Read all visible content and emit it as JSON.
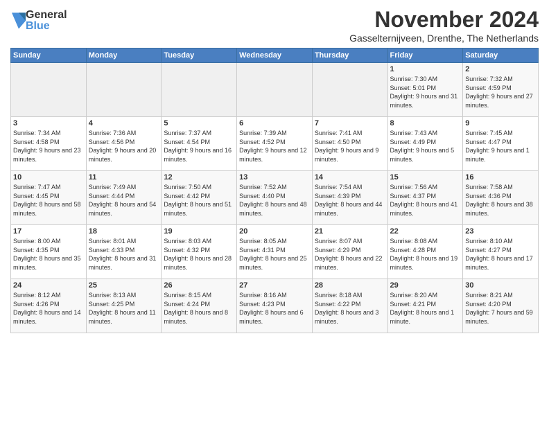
{
  "logo": {
    "general": "General",
    "blue": "Blue"
  },
  "title": {
    "month": "November 2024",
    "location": "Gasselternijveen, Drenthe, The Netherlands"
  },
  "weekdays": [
    "Sunday",
    "Monday",
    "Tuesday",
    "Wednesday",
    "Thursday",
    "Friday",
    "Saturday"
  ],
  "weeks": [
    [
      {
        "day": "",
        "info": ""
      },
      {
        "day": "",
        "info": ""
      },
      {
        "day": "",
        "info": ""
      },
      {
        "day": "",
        "info": ""
      },
      {
        "day": "",
        "info": ""
      },
      {
        "day": "1",
        "info": "Sunrise: 7:30 AM\nSunset: 5:01 PM\nDaylight: 9 hours and 31 minutes."
      },
      {
        "day": "2",
        "info": "Sunrise: 7:32 AM\nSunset: 4:59 PM\nDaylight: 9 hours and 27 minutes."
      }
    ],
    [
      {
        "day": "3",
        "info": "Sunrise: 7:34 AM\nSunset: 4:58 PM\nDaylight: 9 hours and 23 minutes."
      },
      {
        "day": "4",
        "info": "Sunrise: 7:36 AM\nSunset: 4:56 PM\nDaylight: 9 hours and 20 minutes."
      },
      {
        "day": "5",
        "info": "Sunrise: 7:37 AM\nSunset: 4:54 PM\nDaylight: 9 hours and 16 minutes."
      },
      {
        "day": "6",
        "info": "Sunrise: 7:39 AM\nSunset: 4:52 PM\nDaylight: 9 hours and 12 minutes."
      },
      {
        "day": "7",
        "info": "Sunrise: 7:41 AM\nSunset: 4:50 PM\nDaylight: 9 hours and 9 minutes."
      },
      {
        "day": "8",
        "info": "Sunrise: 7:43 AM\nSunset: 4:49 PM\nDaylight: 9 hours and 5 minutes."
      },
      {
        "day": "9",
        "info": "Sunrise: 7:45 AM\nSunset: 4:47 PM\nDaylight: 9 hours and 1 minute."
      }
    ],
    [
      {
        "day": "10",
        "info": "Sunrise: 7:47 AM\nSunset: 4:45 PM\nDaylight: 8 hours and 58 minutes."
      },
      {
        "day": "11",
        "info": "Sunrise: 7:49 AM\nSunset: 4:44 PM\nDaylight: 8 hours and 54 minutes."
      },
      {
        "day": "12",
        "info": "Sunrise: 7:50 AM\nSunset: 4:42 PM\nDaylight: 8 hours and 51 minutes."
      },
      {
        "day": "13",
        "info": "Sunrise: 7:52 AM\nSunset: 4:40 PM\nDaylight: 8 hours and 48 minutes."
      },
      {
        "day": "14",
        "info": "Sunrise: 7:54 AM\nSunset: 4:39 PM\nDaylight: 8 hours and 44 minutes."
      },
      {
        "day": "15",
        "info": "Sunrise: 7:56 AM\nSunset: 4:37 PM\nDaylight: 8 hours and 41 minutes."
      },
      {
        "day": "16",
        "info": "Sunrise: 7:58 AM\nSunset: 4:36 PM\nDaylight: 8 hours and 38 minutes."
      }
    ],
    [
      {
        "day": "17",
        "info": "Sunrise: 8:00 AM\nSunset: 4:35 PM\nDaylight: 8 hours and 35 minutes."
      },
      {
        "day": "18",
        "info": "Sunrise: 8:01 AM\nSunset: 4:33 PM\nDaylight: 8 hours and 31 minutes."
      },
      {
        "day": "19",
        "info": "Sunrise: 8:03 AM\nSunset: 4:32 PM\nDaylight: 8 hours and 28 minutes."
      },
      {
        "day": "20",
        "info": "Sunrise: 8:05 AM\nSunset: 4:31 PM\nDaylight: 8 hours and 25 minutes."
      },
      {
        "day": "21",
        "info": "Sunrise: 8:07 AM\nSunset: 4:29 PM\nDaylight: 8 hours and 22 minutes."
      },
      {
        "day": "22",
        "info": "Sunrise: 8:08 AM\nSunset: 4:28 PM\nDaylight: 8 hours and 19 minutes."
      },
      {
        "day": "23",
        "info": "Sunrise: 8:10 AM\nSunset: 4:27 PM\nDaylight: 8 hours and 17 minutes."
      }
    ],
    [
      {
        "day": "24",
        "info": "Sunrise: 8:12 AM\nSunset: 4:26 PM\nDaylight: 8 hours and 14 minutes."
      },
      {
        "day": "25",
        "info": "Sunrise: 8:13 AM\nSunset: 4:25 PM\nDaylight: 8 hours and 11 minutes."
      },
      {
        "day": "26",
        "info": "Sunrise: 8:15 AM\nSunset: 4:24 PM\nDaylight: 8 hours and 8 minutes."
      },
      {
        "day": "27",
        "info": "Sunrise: 8:16 AM\nSunset: 4:23 PM\nDaylight: 8 hours and 6 minutes."
      },
      {
        "day": "28",
        "info": "Sunrise: 8:18 AM\nSunset: 4:22 PM\nDaylight: 8 hours and 3 minutes."
      },
      {
        "day": "29",
        "info": "Sunrise: 8:20 AM\nSunset: 4:21 PM\nDaylight: 8 hours and 1 minute."
      },
      {
        "day": "30",
        "info": "Sunrise: 8:21 AM\nSunset: 4:20 PM\nDaylight: 7 hours and 59 minutes."
      }
    ]
  ]
}
